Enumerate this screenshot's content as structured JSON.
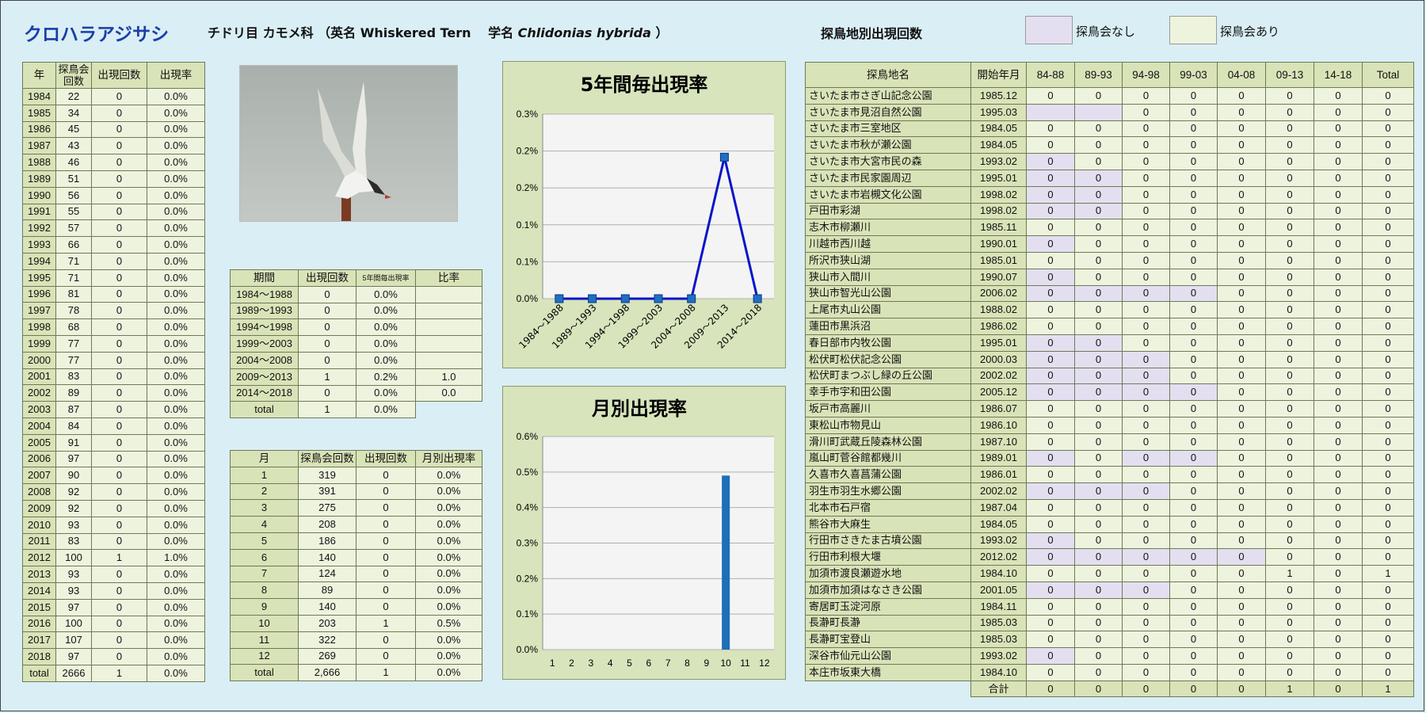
{
  "header": {
    "species": "クロハラアジサシ",
    "order_family": "チドリ目 カモメ科",
    "english_prefix": "（英名 Whiskered Tern　 学名 ",
    "latin": "Chlidonias hybrida",
    "latin_suffix": " ）",
    "site_section_title": "探鳥地別出現回数",
    "legend_no_meeting": "探鳥会なし",
    "legend_with_meeting": "探鳥会あり"
  },
  "colors": {
    "no_meeting": "#e4dff0",
    "with_meeting": "#eef3de",
    "header": "#d9e3b8",
    "line": "#0a14c8",
    "marker": "#1f6fc4",
    "bar": "#1d6fb8"
  },
  "yearly": {
    "headers": [
      "年",
      "探鳥会回数",
      "出現回数",
      "出現率"
    ],
    "rows": [
      [
        "1984",
        "22",
        "0",
        "0.0%"
      ],
      [
        "1985",
        "34",
        "0",
        "0.0%"
      ],
      [
        "1986",
        "45",
        "0",
        "0.0%"
      ],
      [
        "1987",
        "43",
        "0",
        "0.0%"
      ],
      [
        "1988",
        "46",
        "0",
        "0.0%"
      ],
      [
        "1989",
        "51",
        "0",
        "0.0%"
      ],
      [
        "1990",
        "56",
        "0",
        "0.0%"
      ],
      [
        "1991",
        "55",
        "0",
        "0.0%"
      ],
      [
        "1992",
        "57",
        "0",
        "0.0%"
      ],
      [
        "1993",
        "66",
        "0",
        "0.0%"
      ],
      [
        "1994",
        "71",
        "0",
        "0.0%"
      ],
      [
        "1995",
        "71",
        "0",
        "0.0%"
      ],
      [
        "1996",
        "81",
        "0",
        "0.0%"
      ],
      [
        "1997",
        "78",
        "0",
        "0.0%"
      ],
      [
        "1998",
        "68",
        "0",
        "0.0%"
      ],
      [
        "1999",
        "77",
        "0",
        "0.0%"
      ],
      [
        "2000",
        "77",
        "0",
        "0.0%"
      ],
      [
        "2001",
        "83",
        "0",
        "0.0%"
      ],
      [
        "2002",
        "89",
        "0",
        "0.0%"
      ],
      [
        "2003",
        "87",
        "0",
        "0.0%"
      ],
      [
        "2004",
        "84",
        "0",
        "0.0%"
      ],
      [
        "2005",
        "91",
        "0",
        "0.0%"
      ],
      [
        "2006",
        "97",
        "0",
        "0.0%"
      ],
      [
        "2007",
        "90",
        "0",
        "0.0%"
      ],
      [
        "2008",
        "92",
        "0",
        "0.0%"
      ],
      [
        "2009",
        "92",
        "0",
        "0.0%"
      ],
      [
        "2010",
        "93",
        "0",
        "0.0%"
      ],
      [
        "2011",
        "83",
        "0",
        "0.0%"
      ],
      [
        "2012",
        "100",
        "1",
        "1.0%"
      ],
      [
        "2013",
        "93",
        "0",
        "0.0%"
      ],
      [
        "2014",
        "93",
        "0",
        "0.0%"
      ],
      [
        "2015",
        "97",
        "0",
        "0.0%"
      ],
      [
        "2016",
        "100",
        "0",
        "0.0%"
      ],
      [
        "2017",
        "107",
        "0",
        "0.0%"
      ],
      [
        "2018",
        "97",
        "0",
        "0.0%"
      ],
      [
        "total",
        "2666",
        "1",
        "0.0%"
      ]
    ]
  },
  "period_table": {
    "headers": [
      "期間",
      "出現回数",
      "5年間毎出現率",
      "比率"
    ],
    "rows": [
      [
        "1984～1988",
        "0",
        "0.0%",
        ""
      ],
      [
        "1989～1993",
        "0",
        "0.0%",
        ""
      ],
      [
        "1994～1998",
        "0",
        "0.0%",
        ""
      ],
      [
        "1999～2003",
        "0",
        "0.0%",
        ""
      ],
      [
        "2004～2008",
        "0",
        "0.0%",
        ""
      ],
      [
        "2009～2013",
        "1",
        "0.2%",
        "1.0"
      ],
      [
        "2014～2018",
        "0",
        "0.0%",
        "0.0"
      ],
      [
        "total",
        "1",
        "0.0%",
        ""
      ]
    ]
  },
  "monthly_table": {
    "headers": [
      "月",
      "探鳥会回数",
      "出現回数",
      "月別出現率"
    ],
    "rows": [
      [
        "1",
        "319",
        "0",
        "0.0%"
      ],
      [
        "2",
        "391",
        "0",
        "0.0%"
      ],
      [
        "3",
        "275",
        "0",
        "0.0%"
      ],
      [
        "4",
        "208",
        "0",
        "0.0%"
      ],
      [
        "5",
        "186",
        "0",
        "0.0%"
      ],
      [
        "6",
        "140",
        "0",
        "0.0%"
      ],
      [
        "7",
        "124",
        "0",
        "0.0%"
      ],
      [
        "8",
        "89",
        "0",
        "0.0%"
      ],
      [
        "9",
        "140",
        "0",
        "0.0%"
      ],
      [
        "10",
        "203",
        "1",
        "0.5%"
      ],
      [
        "11",
        "322",
        "0",
        "0.0%"
      ],
      [
        "12",
        "269",
        "0",
        "0.0%"
      ],
      [
        "total",
        "2,666",
        "1",
        "0.0%"
      ]
    ]
  },
  "site_table": {
    "headers": [
      "探鳥地名",
      "開始年月",
      "84-88",
      "89-93",
      "94-98",
      "99-03",
      "04-08",
      "09-13",
      "14-18",
      "Total"
    ],
    "rows": [
      {
        "name": "さいたま市さぎ山記念公園",
        "start": "1985.12",
        "v": [
          "0",
          "0",
          "0",
          "0",
          "0",
          "0",
          "0",
          "0"
        ],
        "na": []
      },
      {
        "name": "さいたま市見沼自然公園",
        "start": "1995.03",
        "v": [
          "",
          "",
          "0",
          "0",
          "0",
          "0",
          "0",
          "0"
        ],
        "na": [
          0,
          1
        ]
      },
      {
        "name": "さいたま市三室地区",
        "start": "1984.05",
        "v": [
          "0",
          "0",
          "0",
          "0",
          "0",
          "0",
          "0",
          "0"
        ],
        "na": []
      },
      {
        "name": "さいたま市秋が瀬公園",
        "start": "1984.05",
        "v": [
          "0",
          "0",
          "0",
          "0",
          "0",
          "0",
          "0",
          "0"
        ],
        "na": []
      },
      {
        "name": "さいたま市大宮市民の森",
        "start": "1993.02",
        "v": [
          "0",
          "0",
          "0",
          "0",
          "0",
          "0",
          "0",
          "0"
        ],
        "na": [
          0
        ]
      },
      {
        "name": "さいたま市民家園周辺",
        "start": "1995.01",
        "v": [
          "0",
          "0",
          "0",
          "0",
          "0",
          "0",
          "0",
          "0"
        ],
        "na": [
          0,
          1
        ]
      },
      {
        "name": "さいたま市岩槻文化公園",
        "start": "1998.02",
        "v": [
          "0",
          "0",
          "0",
          "0",
          "0",
          "0",
          "0",
          "0"
        ],
        "na": [
          0,
          1
        ]
      },
      {
        "name": "戸田市彩湖",
        "start": "1998.02",
        "v": [
          "0",
          "0",
          "0",
          "0",
          "0",
          "0",
          "0",
          "0"
        ],
        "na": [
          0,
          1
        ]
      },
      {
        "name": "志木市柳瀬川",
        "start": "1985.11",
        "v": [
          "0",
          "0",
          "0",
          "0",
          "0",
          "0",
          "0",
          "0"
        ],
        "na": []
      },
      {
        "name": "川越市西川越",
        "start": "1990.01",
        "v": [
          "0",
          "0",
          "0",
          "0",
          "0",
          "0",
          "0",
          "0"
        ],
        "na": [
          0
        ]
      },
      {
        "name": "所沢市狭山湖",
        "start": "1985.01",
        "v": [
          "0",
          "0",
          "0",
          "0",
          "0",
          "0",
          "0",
          "0"
        ],
        "na": []
      },
      {
        "name": "狭山市入間川",
        "start": "1990.07",
        "v": [
          "0",
          "0",
          "0",
          "0",
          "0",
          "0",
          "0",
          "0"
        ],
        "na": [
          0
        ]
      },
      {
        "name": "狭山市智光山公園",
        "start": "2006.02",
        "v": [
          "0",
          "0",
          "0",
          "0",
          "0",
          "0",
          "0",
          "0"
        ],
        "na": [
          0,
          1,
          2,
          3
        ]
      },
      {
        "name": "上尾市丸山公園",
        "start": "1988.02",
        "v": [
          "0",
          "0",
          "0",
          "0",
          "0",
          "0",
          "0",
          "0"
        ],
        "na": []
      },
      {
        "name": "蓮田市黒浜沼",
        "start": "1986.02",
        "v": [
          "0",
          "0",
          "0",
          "0",
          "0",
          "0",
          "0",
          "0"
        ],
        "na": []
      },
      {
        "name": "春日部市内牧公園",
        "start": "1995.01",
        "v": [
          "0",
          "0",
          "0",
          "0",
          "0",
          "0",
          "0",
          "0"
        ],
        "na": [
          0,
          1
        ]
      },
      {
        "name": "松伏町松伏記念公園",
        "start": "2000.03",
        "v": [
          "0",
          "0",
          "0",
          "0",
          "0",
          "0",
          "0",
          "0"
        ],
        "na": [
          0,
          1,
          2
        ]
      },
      {
        "name": "松伏町まつぶし緑の丘公園",
        "start": "2002.02",
        "v": [
          "0",
          "0",
          "0",
          "0",
          "0",
          "0",
          "0",
          "0"
        ],
        "na": [
          0,
          1,
          2
        ]
      },
      {
        "name": "幸手市宇和田公園",
        "start": "2005.12",
        "v": [
          "0",
          "0",
          "0",
          "0",
          "0",
          "0",
          "0",
          "0"
        ],
        "na": [
          0,
          1,
          2,
          3
        ]
      },
      {
        "name": "坂戸市高麗川",
        "start": "1986.07",
        "v": [
          "0",
          "0",
          "0",
          "0",
          "0",
          "0",
          "0",
          "0"
        ],
        "na": []
      },
      {
        "name": "東松山市物見山",
        "start": "1986.10",
        "v": [
          "0",
          "0",
          "0",
          "0",
          "0",
          "0",
          "0",
          "0"
        ],
        "na": []
      },
      {
        "name": "滑川町武蔵丘陵森林公園",
        "start": "1987.10",
        "v": [
          "0",
          "0",
          "0",
          "0",
          "0",
          "0",
          "0",
          "0"
        ],
        "na": []
      },
      {
        "name": "嵐山町菅谷館都幾川",
        "start": "1989.01",
        "v": [
          "0",
          "0",
          "0",
          "0",
          "0",
          "0",
          "0",
          "0"
        ],
        "na": [
          0,
          2,
          3
        ]
      },
      {
        "name": "久喜市久喜菖蒲公園",
        "start": "1986.01",
        "v": [
          "0",
          "0",
          "0",
          "0",
          "0",
          "0",
          "0",
          "0"
        ],
        "na": []
      },
      {
        "name": "羽生市羽生水郷公園",
        "start": "2002.02",
        "v": [
          "0",
          "0",
          "0",
          "0",
          "0",
          "0",
          "0",
          "0"
        ],
        "na": [
          0,
          1,
          2
        ]
      },
      {
        "name": "北本市石戸宿",
        "start": "1987.04",
        "v": [
          "0",
          "0",
          "0",
          "0",
          "0",
          "0",
          "0",
          "0"
        ],
        "na": []
      },
      {
        "name": "熊谷市大麻生",
        "start": "1984.05",
        "v": [
          "0",
          "0",
          "0",
          "0",
          "0",
          "0",
          "0",
          "0"
        ],
        "na": []
      },
      {
        "name": "行田市さきたま古墳公園",
        "start": "1993.02",
        "v": [
          "0",
          "0",
          "0",
          "0",
          "0",
          "0",
          "0",
          "0"
        ],
        "na": [
          0
        ]
      },
      {
        "name": "行田市利根大堰",
        "start": "2012.02",
        "v": [
          "0",
          "0",
          "0",
          "0",
          "0",
          "0",
          "0",
          "0"
        ],
        "na": [
          0,
          1,
          2,
          3,
          4
        ]
      },
      {
        "name": "加須市渡良瀬遊水地",
        "start": "1984.10",
        "v": [
          "0",
          "0",
          "0",
          "0",
          "0",
          "1",
          "0",
          "1"
        ],
        "na": []
      },
      {
        "name": "加須市加須はなさき公園",
        "start": "2001.05",
        "v": [
          "0",
          "0",
          "0",
          "0",
          "0",
          "0",
          "0",
          "0"
        ],
        "na": [
          0,
          1,
          2
        ]
      },
      {
        "name": "寄居町玉淀河原",
        "start": "1984.11",
        "v": [
          "0",
          "0",
          "0",
          "0",
          "0",
          "0",
          "0",
          "0"
        ],
        "na": []
      },
      {
        "name": "長瀞町長瀞",
        "start": "1985.03",
        "v": [
          "0",
          "0",
          "0",
          "0",
          "0",
          "0",
          "0",
          "0"
        ],
        "na": []
      },
      {
        "name": "長瀞町宝登山",
        "start": "1985.03",
        "v": [
          "0",
          "0",
          "0",
          "0",
          "0",
          "0",
          "0",
          "0"
        ],
        "na": []
      },
      {
        "name": "深谷市仙元山公園",
        "start": "1993.02",
        "v": [
          "0",
          "0",
          "0",
          "0",
          "0",
          "0",
          "0",
          "0"
        ],
        "na": [
          0
        ]
      },
      {
        "name": "本庄市坂東大橋",
        "start": "1984.10",
        "v": [
          "0",
          "0",
          "0",
          "0",
          "0",
          "0",
          "0",
          "0"
        ],
        "na": []
      }
    ],
    "total_label": "合計",
    "totals": [
      "0",
      "0",
      "0",
      "0",
      "0",
      "1",
      "0",
      "1"
    ]
  },
  "chart_data": [
    {
      "type": "line",
      "title": "5年間毎出現率",
      "categories": [
        "1984～1988",
        "1989～1993",
        "1994～1998",
        "1999～2003",
        "2004～2008",
        "2009～2013",
        "2014～2018"
      ],
      "values": [
        0,
        0,
        0,
        0,
        0,
        0.23,
        0
      ],
      "y_unit": "%",
      "ylim": [
        0,
        0.3
      ],
      "yticks": [
        "0.0%",
        "0.1%",
        "0.1%",
        "0.2%",
        "0.2%",
        "0.3%"
      ],
      "grid": true
    },
    {
      "type": "bar",
      "title": "月別出現率",
      "categories": [
        "1",
        "2",
        "3",
        "4",
        "5",
        "6",
        "7",
        "8",
        "9",
        "10",
        "11",
        "12"
      ],
      "values": [
        0,
        0,
        0,
        0,
        0,
        0,
        0,
        0,
        0,
        0.49,
        0,
        0
      ],
      "y_unit": "%",
      "ylim": [
        0,
        0.6
      ],
      "yticks": [
        "0.0%",
        "0.1%",
        "0.2%",
        "0.3%",
        "0.4%",
        "0.5%",
        "0.6%"
      ],
      "grid": true
    }
  ]
}
